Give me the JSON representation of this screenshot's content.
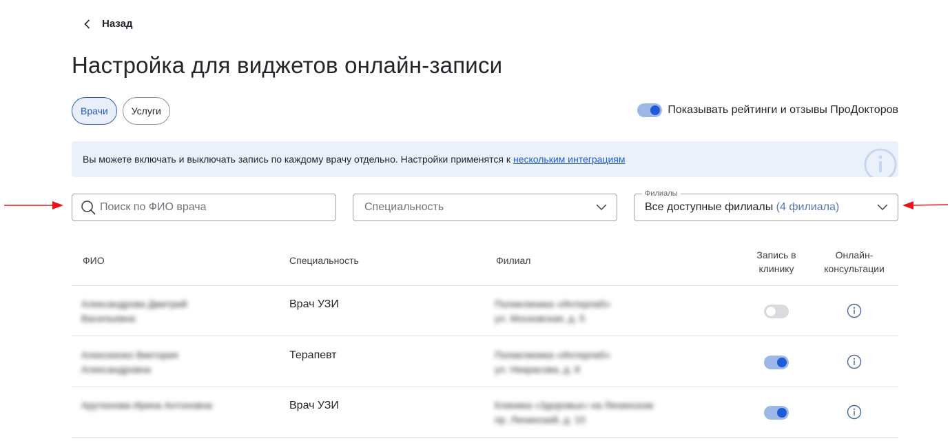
{
  "nav": {
    "back_label": "Назад"
  },
  "page_title": "Настройка для виджетов онлайн-записи",
  "tabs": [
    {
      "label": "Врачи",
      "active": true
    },
    {
      "label": "Услуги",
      "active": false
    }
  ],
  "rating_toggle": {
    "label": "Показывать рейтинги и отзывы ПроДокторов",
    "on": true
  },
  "banner": {
    "text": "Вы можете включать и выключать запись по каждому врачу отдельно. Настройки применятся к",
    "link": "нескольким интеграциям",
    "icon": "info-icon"
  },
  "filters": {
    "search_placeholder": "Поиск по ФИО врача",
    "specialty_placeholder": "Специальность",
    "branches_legend": "Филиалы",
    "branches_value": "Все доступные филиалы",
    "branches_count": "(4 филиала)"
  },
  "table": {
    "headers": {
      "name": "ФИО",
      "specialty": "Специальность",
      "branch": "Филиал",
      "clinic_booking": "Запись в клинику",
      "online_consult": "Онлайн-консультации"
    },
    "rows": [
      {
        "name_line1": "Александрова Дмитрий",
        "name_line2": "Васильевна",
        "specialty": "Врач УЗИ",
        "branch_line1": "Поликлиника «Интерлаб»",
        "branch_line2": "ул. Московская, д. 5",
        "clinic_booking": false
      },
      {
        "name_line1": "Алексеенко Виктория",
        "name_line2": "Александровна",
        "specialty": "Терапевт",
        "branch_line1": "Поликлиника «Интерлаб»",
        "branch_line2": "ул. Некрасова, д. 8",
        "clinic_booking": true
      },
      {
        "name_line1": "Арутюнова Ирина Антоновна",
        "name_line2": "",
        "specialty": "Врач УЗИ",
        "branch_line1": "Клиника «Здоровье» на Ленинском",
        "branch_line2": "пр. Ленинский, д. 10",
        "clinic_booking": true
      }
    ]
  },
  "colors": {
    "accent": "#1f5bd6",
    "arrow": "#e8141c",
    "banner_bg": "#ebf1fb"
  }
}
